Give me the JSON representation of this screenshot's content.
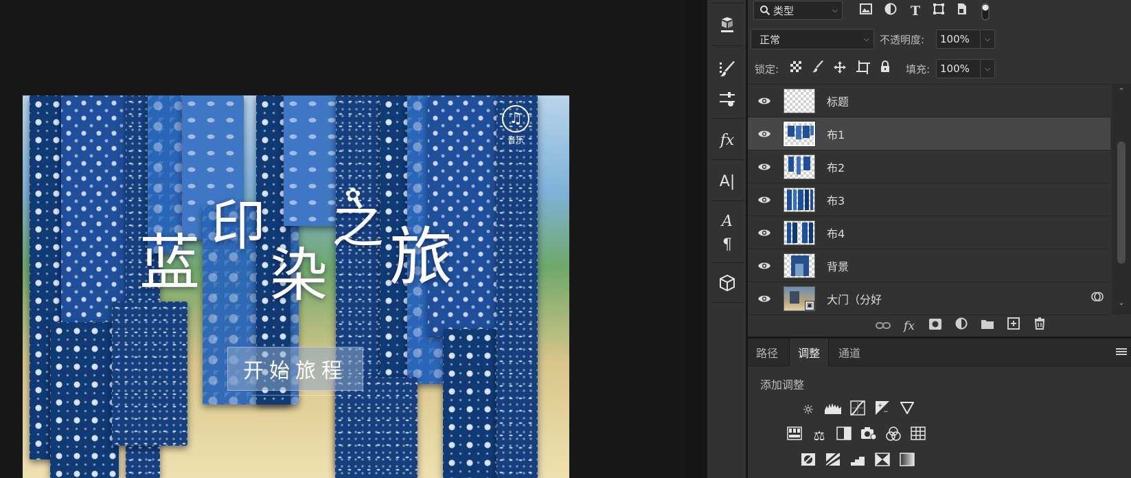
{
  "canvas": {
    "title_chars": [
      "蓝",
      "印",
      "染",
      "之",
      "旅"
    ],
    "flower_glyph": "✿",
    "music_glyph": "♫",
    "music_label": "音乐",
    "start_button": "开始旅程"
  },
  "tool_strip": {
    "icons": [
      "3d-object-icon",
      "history-brush-icon",
      "properties-sliders-icon",
      "fx-styles-icon",
      "character-icon",
      "glyphs-icon",
      "paragraph-icon",
      "3d-cube-icon"
    ],
    "labels": {
      "fx": "fx",
      "character": "A|",
      "glyphs": "A",
      "paragraph": "¶"
    }
  },
  "layers_panel": {
    "filter": {
      "label": "类型",
      "search_glyph": "🔍"
    },
    "filter_icons": [
      "image-filter-icon",
      "adjustment-filter-icon",
      "type-filter-icon",
      "shape-filter-icon",
      "smart-object-filter-icon",
      "filter-toggle-icon"
    ],
    "blend_mode": "正常",
    "opacity_label": "不透明度:",
    "opacity_value": "100%",
    "lock_label": "锁定:",
    "fill_label": "填充:",
    "fill_value": "100%",
    "layers": [
      {
        "name": "标题",
        "thumb": "empty",
        "selected": false
      },
      {
        "name": "布1",
        "thumb": "cloth-1",
        "selected": true
      },
      {
        "name": "布2",
        "thumb": "cloth-2",
        "selected": false
      },
      {
        "name": "布3",
        "thumb": "cloth-3",
        "selected": false
      },
      {
        "name": "布4",
        "thumb": "cloth-4",
        "selected": false
      },
      {
        "name": "背景",
        "thumb": "background",
        "selected": false
      },
      {
        "name": "大门（分好",
        "thumb": "door",
        "selected": false,
        "smart_object": true
      }
    ],
    "footer_icons": [
      "link-layers-icon",
      "fx-icon",
      "mask-icon",
      "adjustment-layer-icon",
      "group-folder-icon",
      "new-layer-icon",
      "delete-layer-icon"
    ]
  },
  "adjustments_panel": {
    "tabs": [
      "路径",
      "调整",
      "通道"
    ],
    "active_tab": "调整",
    "heading": "添加调整",
    "rows": [
      [
        "brightness-icon",
        "levels-icon",
        "curves-icon",
        "exposure-icon",
        "gradient-triangle-icon"
      ],
      [
        "vibrance-icon",
        "color-balance-icon",
        "black-white-icon",
        "photo-filter-icon",
        "channel-mixer-icon",
        "color-lookup-icon"
      ],
      [
        "invert-icon",
        "posterize-icon",
        "threshold-icon",
        "selective-color-icon",
        "gradient-map-icon"
      ]
    ]
  },
  "colors": {
    "panel_bg": "#323232",
    "canvas_bg": "#181818",
    "selected_row": "#474747",
    "indigo": "#1f4f9a"
  }
}
